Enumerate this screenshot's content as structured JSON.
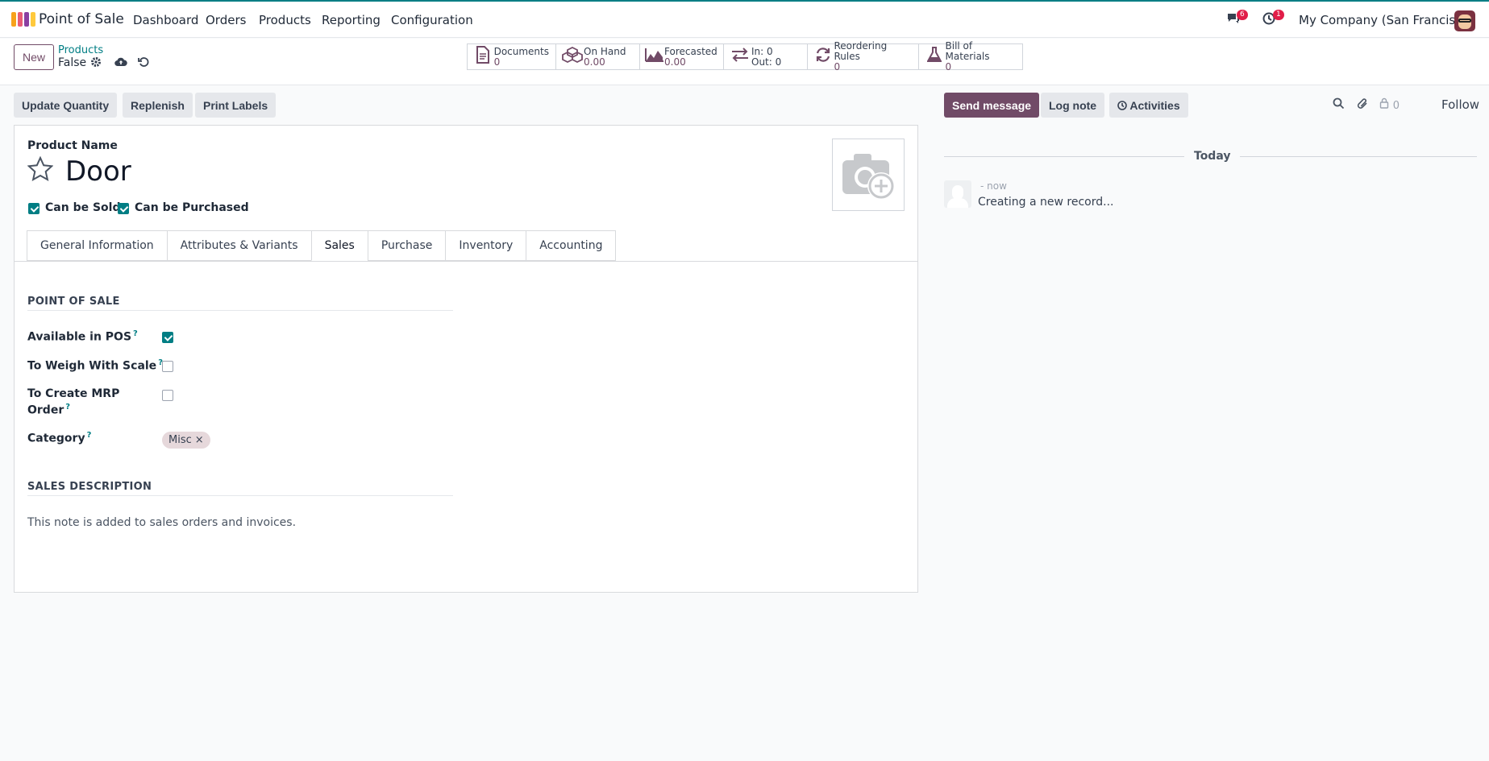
{
  "app": {
    "title": "Point of Sale",
    "logo_colors": [
      "#f7a21b",
      "#e85d75",
      "#8a3fa1",
      "#ffc93c"
    ]
  },
  "menu": [
    {
      "label": "Dashboard"
    },
    {
      "label": "Orders"
    },
    {
      "label": "Products"
    },
    {
      "label": "Reporting"
    },
    {
      "label": "Configuration"
    }
  ],
  "systray": {
    "messages_badge": "6",
    "activities_badge": "1",
    "company": "My Company (San Francisco)"
  },
  "control_panel": {
    "new_label": "New",
    "breadcrumb_parent": "Products",
    "breadcrumb_current": "False"
  },
  "smart_buttons": [
    {
      "icon": "documents-icon",
      "label": "Documents",
      "value": "0"
    },
    {
      "icon": "cubes-icon",
      "label": "On Hand",
      "value": "0.00"
    },
    {
      "icon": "area-chart-icon",
      "label": "Forecasted",
      "value": "0.00"
    },
    {
      "icon": "exchange-icon",
      "label": "In: 0",
      "value": "Out: 0"
    },
    {
      "icon": "refresh-icon",
      "label": "Reordering Rules",
      "value": "0"
    },
    {
      "icon": "flask-icon",
      "label": "Bill of Materials",
      "value": "0"
    }
  ],
  "actions": {
    "update_quantity": "Update Quantity",
    "replenish": "Replenish",
    "print_labels": "Print Labels"
  },
  "form": {
    "product_name_label": "Product Name",
    "product_name": "Door",
    "can_be_sold": "Can be Sold",
    "can_be_purchased": "Can be Purchased",
    "can_be_sold_checked": true,
    "can_be_purchased_checked": true,
    "tabs": [
      {
        "label": "General Information"
      },
      {
        "label": "Attributes & Variants"
      },
      {
        "label": "Sales",
        "active": true
      },
      {
        "label": "Purchase"
      },
      {
        "label": "Inventory"
      },
      {
        "label": "Accounting"
      }
    ],
    "pos_section": "POINT OF SALE",
    "available_in_pos": "Available in POS",
    "available_in_pos_checked": true,
    "to_weigh": "To Weigh With Scale",
    "to_weigh_checked": false,
    "to_create_mrp_line1": "To Create MRP",
    "to_create_mrp_line2": "Order",
    "to_create_mrp_checked": false,
    "category_label": "Category",
    "category_tag": "Misc",
    "help_mark": "?",
    "sales_desc_section": "SALES DESCRIPTION",
    "sales_desc_placeholder": "This note is added to sales orders and invoices."
  },
  "chatter": {
    "send_message": "Send message",
    "log_note": "Log note",
    "activities": "Activities",
    "followers_count": "0",
    "follow": "Follow",
    "today": "Today",
    "message_time": "- now",
    "message_text": "Creating a new record..."
  },
  "colors": {
    "brand": "#714b67",
    "accent": "#017e84",
    "badge": "#e11d48"
  }
}
